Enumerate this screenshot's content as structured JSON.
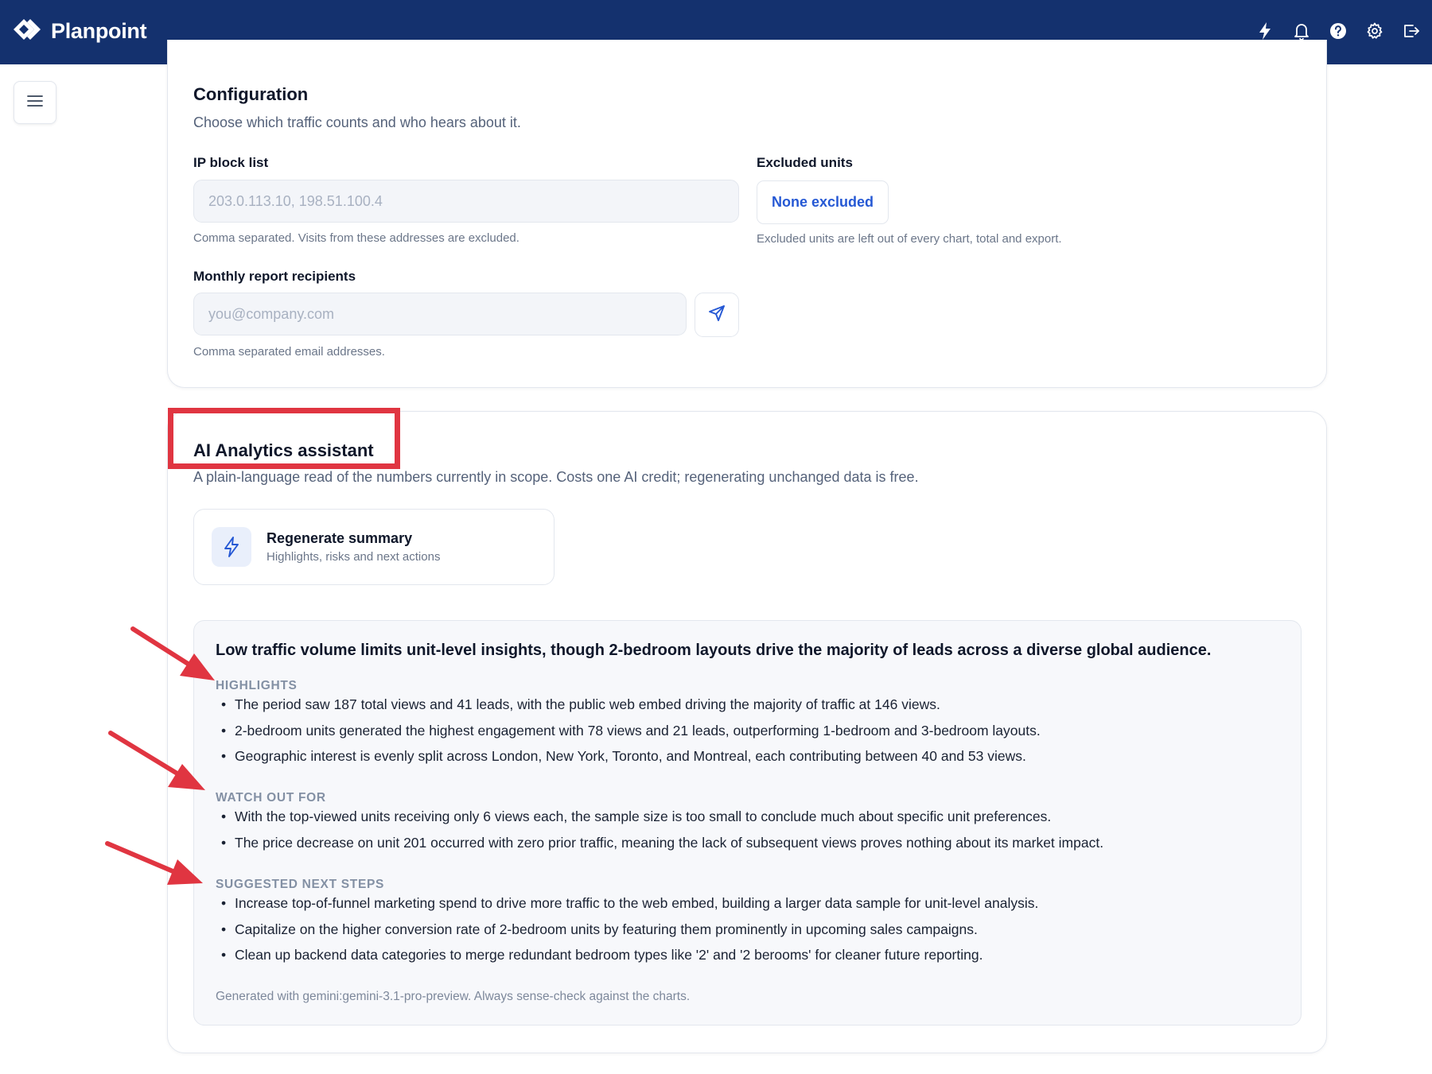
{
  "app": {
    "name": "Planpoint",
    "top_icons": [
      "bolt-icon",
      "bell-icon",
      "help-icon",
      "gear-icon",
      "logout-icon"
    ]
  },
  "configuration": {
    "title": "Configuration",
    "subtitle": "Choose which traffic counts and who hears about it.",
    "ip_block": {
      "label": "IP block list",
      "placeholder": "203.0.113.10, 198.51.100.4",
      "value": "",
      "hint": "Comma separated. Visits from these addresses are excluded."
    },
    "excluded_units": {
      "label": "Excluded units",
      "button_label": "None excluded",
      "hint": "Excluded units are left out of every chart, total and export."
    },
    "recipients": {
      "label": "Monthly report recipients",
      "placeholder": "you@company.com",
      "value": "",
      "hint": "Comma separated email addresses."
    }
  },
  "ai_assistant": {
    "title": "AI Analytics assistant",
    "subtitle": "A plain-language read of the numbers currently in scope. Costs one AI credit; regenerating unchanged data is free.",
    "regenerate": {
      "title": "Regenerate summary",
      "subtitle": "Highlights, risks and next actions"
    },
    "summary": {
      "headline": "Low traffic volume limits unit-level insights, though 2-bedroom layouts drive the majority of leads across a diverse global audience.",
      "sections": [
        {
          "title": "HIGHLIGHTS",
          "items": [
            "The period saw 187 total views and 41 leads, with the public web embed driving the majority of traffic at 146 views.",
            "2-bedroom units generated the highest engagement with 78 views and 21 leads, outperforming 1-bedroom and 3-bedroom layouts.",
            "Geographic interest is evenly split across London, New York, Toronto, and Montreal, each contributing between 40 and 53 views."
          ]
        },
        {
          "title": "WATCH OUT FOR",
          "items": [
            "With the top-viewed units receiving only 6 views each, the sample size is too small to conclude much about specific unit preferences.",
            "The price decrease on unit 201 occurred with zero prior traffic, meaning the lack of subsequent views proves nothing about its market impact."
          ]
        },
        {
          "title": "SUGGESTED NEXT STEPS",
          "items": [
            "Increase top-of-funnel marketing spend to drive more traffic to the web embed, building a larger data sample for unit-level analysis.",
            "Capitalize on the higher conversion rate of 2-bedroom units by featuring them prominently in upcoming sales campaigns.",
            "Clean up backend data categories to merge redundant bedroom types like '2' and '2 berooms' for cleaner future reporting."
          ]
        }
      ],
      "footnote": "Generated with gemini:gemini-3.1-pro-preview. Always sense-check against the charts."
    }
  },
  "colors": {
    "topbar": "#14316e",
    "accent": "#2558d4",
    "annotation": "#e03541"
  }
}
